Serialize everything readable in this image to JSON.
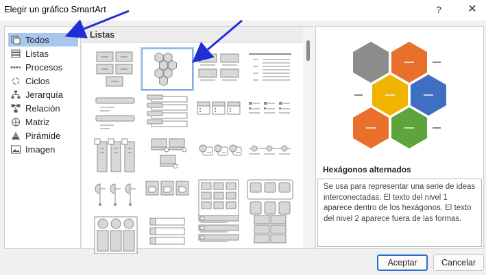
{
  "window": {
    "title": "Elegir un gráfico SmartArt",
    "help_glyph": "?",
    "close_glyph": "✕"
  },
  "categories": [
    {
      "label": "Todos",
      "icon": "all-icon",
      "selected": true
    },
    {
      "label": "Listas",
      "icon": "list-icon"
    },
    {
      "label": "Procesos",
      "icon": "process-icon"
    },
    {
      "label": "Ciclos",
      "icon": "cycle-icon"
    },
    {
      "label": "Jerarquía",
      "icon": "hierarchy-icon"
    },
    {
      "label": "Relación",
      "icon": "relationship-icon"
    },
    {
      "label": "Matriz",
      "icon": "matrix-icon"
    },
    {
      "label": "Pirámide",
      "icon": "pyramid-icon"
    },
    {
      "label": "Imagen",
      "icon": "picture-icon"
    }
  ],
  "gallery": {
    "section_title": "Listas"
  },
  "preview": {
    "layout_name": "Hexágonos alternados",
    "description": "Se usa para representar una serie de ideas interconectadas. El texto del nivel 1 aparece dentro de los hexágonos. El texto del nivel 2 aparece fuera de las formas.",
    "colors": {
      "gray": "#8c8c8c",
      "orange": "#e8702a",
      "gold": "#f0b400",
      "blue": "#3f6fc0",
      "green": "#5ea33b"
    }
  },
  "buttons": {
    "ok_label": "Aceptar",
    "cancel_label": "Cancelar"
  },
  "annotation": {
    "arrow_color": "#1f2fd6"
  }
}
